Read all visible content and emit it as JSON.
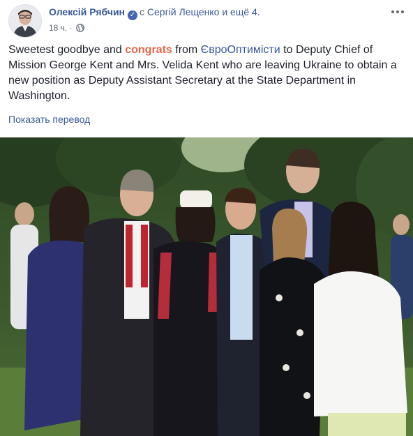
{
  "post": {
    "author": "Олексій Рябчин",
    "with_prefix": "с",
    "tagged_person": "Сергій Лещенко",
    "others_suffix": "и ещё 4.",
    "time": "18 ч.",
    "text": {
      "part1": "Sweetest goodbye and ",
      "highlight": "congrats",
      "part2": " from ",
      "page_link": "ЄвроОптимісти",
      "part3": " to Deputy Chief of Mission George Kent and Mrs. Velida Kent who are leaving Ukraine to obtain a new position as Deputy Assistant Secretary at the State Department in Washington."
    },
    "translate_link": "Показать перевод"
  },
  "icons": {
    "verified": "verified-badge-icon",
    "globe": "globe-icon",
    "menu": "more-options-icon"
  },
  "colors": {
    "link": "#385898",
    "highlight": "#e8674c",
    "meta": "#616770"
  }
}
